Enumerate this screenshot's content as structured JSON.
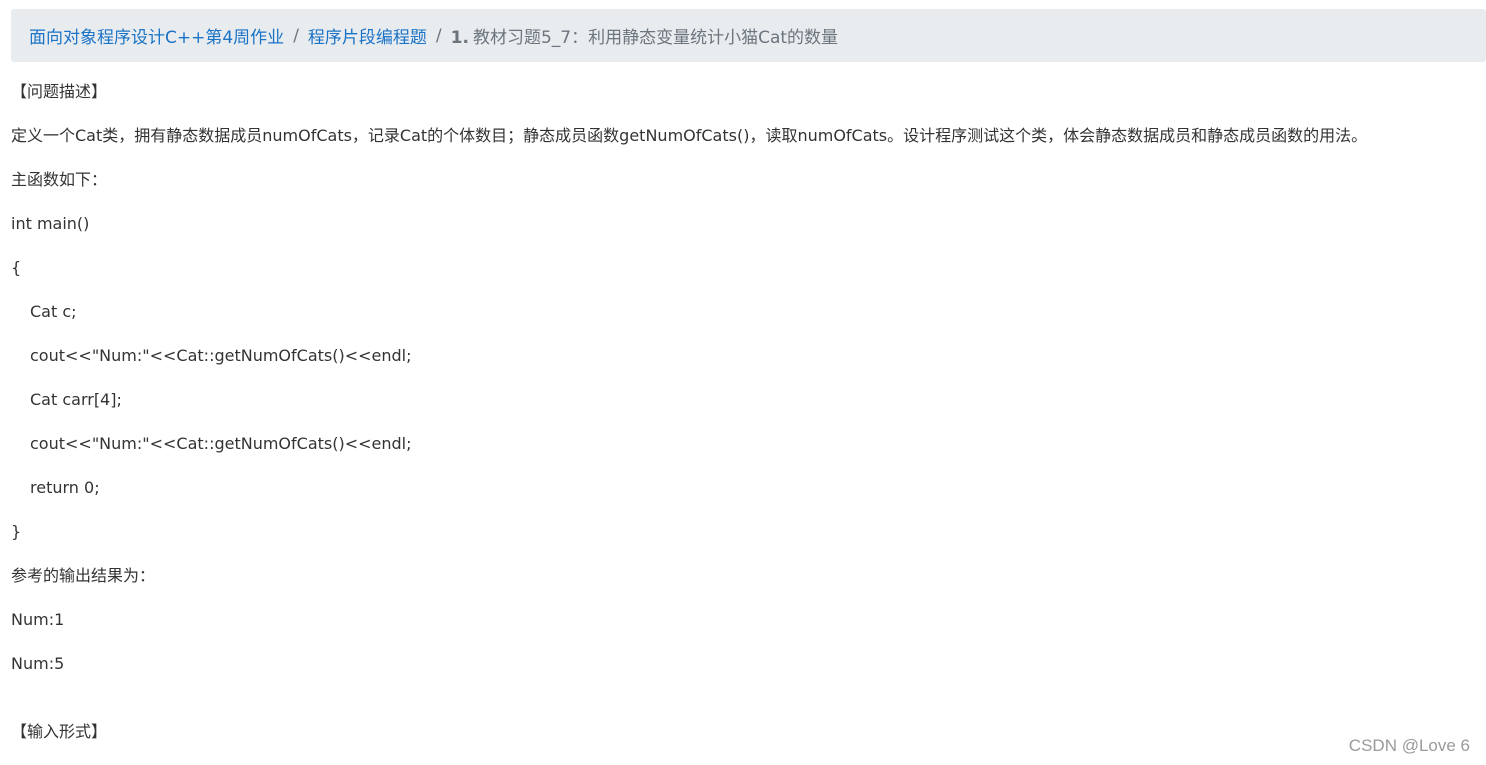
{
  "breadcrumb": {
    "course": "面向对象程序设计C++第4周作业",
    "section": "程序片段编程题",
    "separator": "/",
    "current_number": "1.",
    "current_title": "教材习题5_7：利用静态变量统计小猫Cat的数量"
  },
  "problem": {
    "description_heading": "【问题描述】",
    "description": "定义一个Cat类，拥有静态数据成员numOfCats，记录Cat的个体数目；静态成员函数getNumOfCats()，读取numOfCats。设计程序测试这个类，体会静态数据成员和静态成员函数的用法。",
    "main_intro": "主函数如下：",
    "code": [
      "int main()",
      "{",
      "Cat c;",
      "cout<<\"Num:\"<<Cat::getNumOfCats()<<endl;",
      "Cat carr[4];",
      "cout<<\"Num:\"<<Cat::getNumOfCats()<<endl;",
      "return 0;",
      "}"
    ],
    "output_intro": "参考的输出结果为：",
    "output": [
      "Num:1",
      "Num:5"
    ],
    "input_heading": "【输入形式】"
  },
  "watermark": "CSDN @Love 6"
}
